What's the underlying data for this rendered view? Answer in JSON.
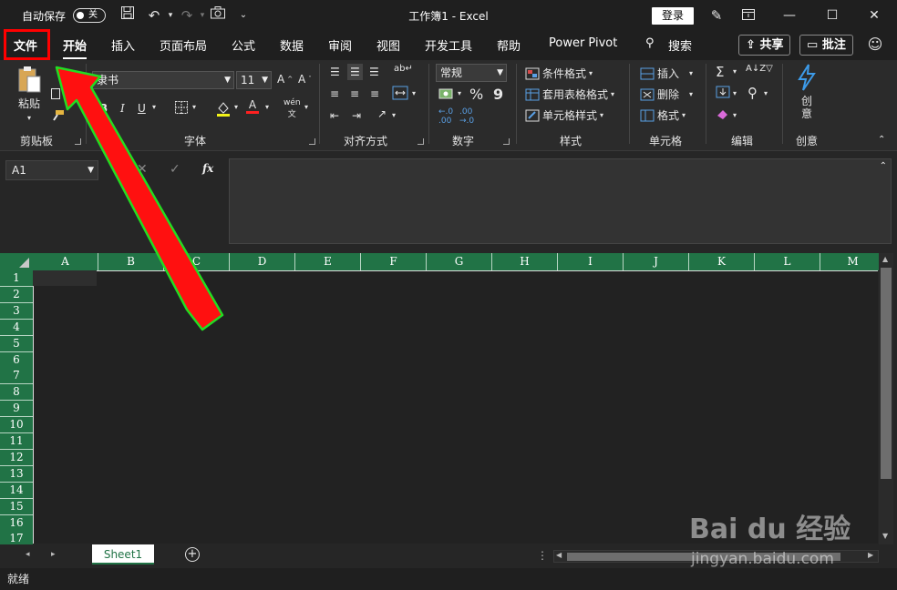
{
  "titlebar": {
    "autosave_label": "自动保存",
    "autosave_state": "关",
    "document_title": "工作簿1  -  Excel",
    "login_label": "登录",
    "icons": [
      "save-icon",
      "undo-icon",
      "redo-icon",
      "camera-icon",
      "customize-dropdown-icon",
      "pen-icon",
      "ribbon-display-icon",
      "minimize-icon",
      "maximize-icon",
      "close-icon"
    ]
  },
  "menu": {
    "tabs": [
      "文件",
      "开始",
      "插入",
      "页面布局",
      "公式",
      "数据",
      "审阅",
      "视图",
      "开发工具",
      "帮助",
      "Power Pivot"
    ],
    "search_label": "搜索",
    "share_label": "共享",
    "comment_label": "批注",
    "active_tab": "开始",
    "highlighted_tab": "文件"
  },
  "ribbon": {
    "clipboard": {
      "label": "剪贴板",
      "paste": "粘贴"
    },
    "font": {
      "label": "字体",
      "font_name": "隶书",
      "font_size": "11",
      "bold": "B",
      "italic": "I",
      "underline": "U",
      "font_color_glyph": "A",
      "phonetic": "wén"
    },
    "alignment": {
      "label": "对齐方式"
    },
    "number": {
      "label": "数字",
      "format": "常规",
      "percent": "%",
      "comma": "9"
    },
    "styles": {
      "label": "样式",
      "conditional": "条件格式",
      "table_format": "套用表格格式",
      "cell_styles": "单元格样式"
    },
    "cells": {
      "label": "单元格",
      "insert": "插入",
      "delete": "删除",
      "format": "格式"
    },
    "editing": {
      "label": "编辑"
    },
    "creative": {
      "label": "创意",
      "button": "创意"
    }
  },
  "formula_bar": {
    "name_box": "A1",
    "fx": "fx"
  },
  "sheet": {
    "columns": [
      "A",
      "B",
      "C",
      "D",
      "E",
      "F",
      "G",
      "H",
      "I",
      "J",
      "K",
      "L",
      "M"
    ],
    "rows": [
      "1",
      "2",
      "3",
      "4",
      "5",
      "6",
      "7",
      "8",
      "9",
      "10",
      "11",
      "12",
      "13",
      "14",
      "15",
      "16",
      "17"
    ],
    "tabs": [
      "Sheet1"
    ],
    "header_color": "#217346"
  },
  "status": {
    "text": "就绪"
  },
  "watermark": {
    "brand": "Bai du 经验",
    "site": "jingyan.baidu.com"
  },
  "annotation": {
    "arrow_color": "#ff0000",
    "arrow_outline": "#22dd22",
    "highlight_color": "#ff0000"
  }
}
